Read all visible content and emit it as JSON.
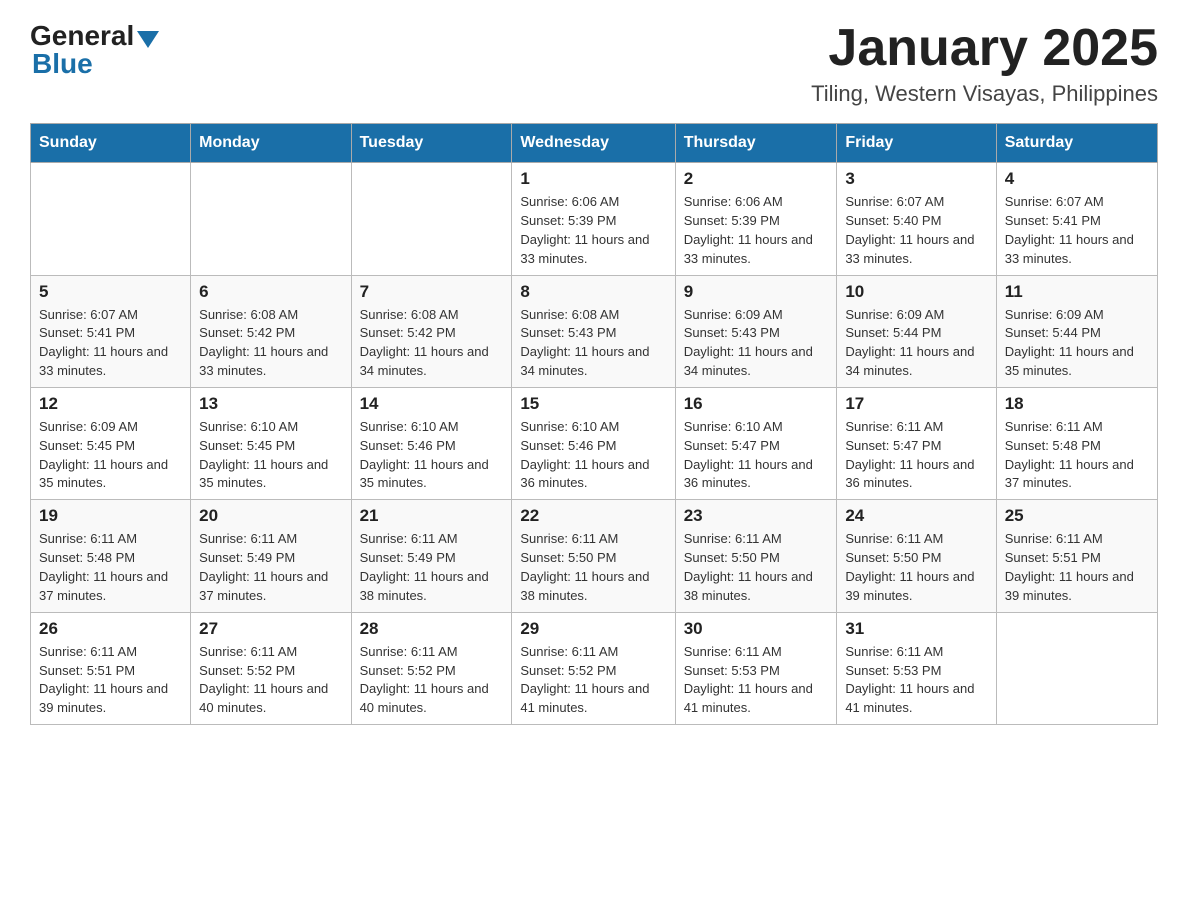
{
  "header": {
    "logo_general": "General",
    "logo_blue": "Blue",
    "title": "January 2025",
    "subtitle": "Tiling, Western Visayas, Philippines"
  },
  "calendar": {
    "days_of_week": [
      "Sunday",
      "Monday",
      "Tuesday",
      "Wednesday",
      "Thursday",
      "Friday",
      "Saturday"
    ],
    "weeks": [
      [
        {
          "day": "",
          "info": ""
        },
        {
          "day": "",
          "info": ""
        },
        {
          "day": "",
          "info": ""
        },
        {
          "day": "1",
          "info": "Sunrise: 6:06 AM\nSunset: 5:39 PM\nDaylight: 11 hours and 33 minutes."
        },
        {
          "day": "2",
          "info": "Sunrise: 6:06 AM\nSunset: 5:39 PM\nDaylight: 11 hours and 33 minutes."
        },
        {
          "day": "3",
          "info": "Sunrise: 6:07 AM\nSunset: 5:40 PM\nDaylight: 11 hours and 33 minutes."
        },
        {
          "day": "4",
          "info": "Sunrise: 6:07 AM\nSunset: 5:41 PM\nDaylight: 11 hours and 33 minutes."
        }
      ],
      [
        {
          "day": "5",
          "info": "Sunrise: 6:07 AM\nSunset: 5:41 PM\nDaylight: 11 hours and 33 minutes."
        },
        {
          "day": "6",
          "info": "Sunrise: 6:08 AM\nSunset: 5:42 PM\nDaylight: 11 hours and 33 minutes."
        },
        {
          "day": "7",
          "info": "Sunrise: 6:08 AM\nSunset: 5:42 PM\nDaylight: 11 hours and 34 minutes."
        },
        {
          "day": "8",
          "info": "Sunrise: 6:08 AM\nSunset: 5:43 PM\nDaylight: 11 hours and 34 minutes."
        },
        {
          "day": "9",
          "info": "Sunrise: 6:09 AM\nSunset: 5:43 PM\nDaylight: 11 hours and 34 minutes."
        },
        {
          "day": "10",
          "info": "Sunrise: 6:09 AM\nSunset: 5:44 PM\nDaylight: 11 hours and 34 minutes."
        },
        {
          "day": "11",
          "info": "Sunrise: 6:09 AM\nSunset: 5:44 PM\nDaylight: 11 hours and 35 minutes."
        }
      ],
      [
        {
          "day": "12",
          "info": "Sunrise: 6:09 AM\nSunset: 5:45 PM\nDaylight: 11 hours and 35 minutes."
        },
        {
          "day": "13",
          "info": "Sunrise: 6:10 AM\nSunset: 5:45 PM\nDaylight: 11 hours and 35 minutes."
        },
        {
          "day": "14",
          "info": "Sunrise: 6:10 AM\nSunset: 5:46 PM\nDaylight: 11 hours and 35 minutes."
        },
        {
          "day": "15",
          "info": "Sunrise: 6:10 AM\nSunset: 5:46 PM\nDaylight: 11 hours and 36 minutes."
        },
        {
          "day": "16",
          "info": "Sunrise: 6:10 AM\nSunset: 5:47 PM\nDaylight: 11 hours and 36 minutes."
        },
        {
          "day": "17",
          "info": "Sunrise: 6:11 AM\nSunset: 5:47 PM\nDaylight: 11 hours and 36 minutes."
        },
        {
          "day": "18",
          "info": "Sunrise: 6:11 AM\nSunset: 5:48 PM\nDaylight: 11 hours and 37 minutes."
        }
      ],
      [
        {
          "day": "19",
          "info": "Sunrise: 6:11 AM\nSunset: 5:48 PM\nDaylight: 11 hours and 37 minutes."
        },
        {
          "day": "20",
          "info": "Sunrise: 6:11 AM\nSunset: 5:49 PM\nDaylight: 11 hours and 37 minutes."
        },
        {
          "day": "21",
          "info": "Sunrise: 6:11 AM\nSunset: 5:49 PM\nDaylight: 11 hours and 38 minutes."
        },
        {
          "day": "22",
          "info": "Sunrise: 6:11 AM\nSunset: 5:50 PM\nDaylight: 11 hours and 38 minutes."
        },
        {
          "day": "23",
          "info": "Sunrise: 6:11 AM\nSunset: 5:50 PM\nDaylight: 11 hours and 38 minutes."
        },
        {
          "day": "24",
          "info": "Sunrise: 6:11 AM\nSunset: 5:50 PM\nDaylight: 11 hours and 39 minutes."
        },
        {
          "day": "25",
          "info": "Sunrise: 6:11 AM\nSunset: 5:51 PM\nDaylight: 11 hours and 39 minutes."
        }
      ],
      [
        {
          "day": "26",
          "info": "Sunrise: 6:11 AM\nSunset: 5:51 PM\nDaylight: 11 hours and 39 minutes."
        },
        {
          "day": "27",
          "info": "Sunrise: 6:11 AM\nSunset: 5:52 PM\nDaylight: 11 hours and 40 minutes."
        },
        {
          "day": "28",
          "info": "Sunrise: 6:11 AM\nSunset: 5:52 PM\nDaylight: 11 hours and 40 minutes."
        },
        {
          "day": "29",
          "info": "Sunrise: 6:11 AM\nSunset: 5:52 PM\nDaylight: 11 hours and 41 minutes."
        },
        {
          "day": "30",
          "info": "Sunrise: 6:11 AM\nSunset: 5:53 PM\nDaylight: 11 hours and 41 minutes."
        },
        {
          "day": "31",
          "info": "Sunrise: 6:11 AM\nSunset: 5:53 PM\nDaylight: 11 hours and 41 minutes."
        },
        {
          "day": "",
          "info": ""
        }
      ]
    ]
  }
}
